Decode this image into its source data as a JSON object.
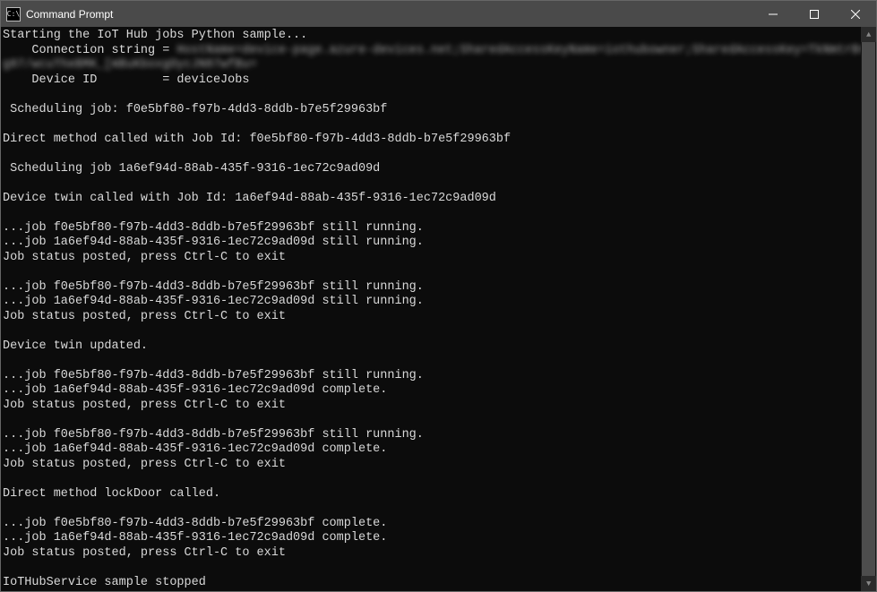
{
  "window": {
    "title": "Command Prompt",
    "sys_icon_label": "C:\\"
  },
  "console": {
    "lines": [
      "Starting the IoT Hub jobs Python sample...",
      "    Connection string = ",
      "",
      "    Device ID         = deviceJobs",
      "",
      " Scheduling job: f0e5bf80-f97b-4dd3-8ddb-b7e5f29963bf",
      "",
      "Direct method called with Job Id: f0e5bf80-f97b-4dd3-8ddb-b7e5f29963bf",
      "",
      " Scheduling job 1a6ef94d-88ab-435f-9316-1ec72c9ad09d",
      "",
      "Device twin called with Job Id: 1a6ef94d-88ab-435f-9316-1ec72c9ad09d",
      "",
      "...job f0e5bf80-f97b-4dd3-8ddb-b7e5f29963bf still running.",
      "...job 1a6ef94d-88ab-435f-9316-1ec72c9ad09d still running.",
      "Job status posted, press Ctrl-C to exit",
      "",
      "...job f0e5bf80-f97b-4dd3-8ddb-b7e5f29963bf still running.",
      "...job 1a6ef94d-88ab-435f-9316-1ec72c9ad09d still running.",
      "Job status posted, press Ctrl-C to exit",
      "",
      "Device twin updated.",
      "",
      "...job f0e5bf80-f97b-4dd3-8ddb-b7e5f29963bf still running.",
      "...job 1a6ef94d-88ab-435f-9316-1ec72c9ad09d complete.",
      "Job status posted, press Ctrl-C to exit",
      "",
      "...job f0e5bf80-f97b-4dd3-8ddb-b7e5f29963bf still running.",
      "...job 1a6ef94d-88ab-435f-9316-1ec72c9ad09d complete.",
      "Job status posted, press Ctrl-C to exit",
      "",
      "Direct method lockDoor called.",
      "",
      "...job f0e5bf80-f97b-4dd3-8ddb-b7e5f29963bf complete.",
      "...job 1a6ef94d-88ab-435f-9316-1ec72c9ad09d complete.",
      "Job status posted, press Ctrl-C to exit",
      "",
      "IoTHubService sample stopped"
    ],
    "redacted_segments": {
      "line1_suffix": "HostName=device-page.azure-devices.net;SharedAccessKeyName=iothubowner;SharedAccessKey=TkNmtrBre",
      "line2": "g07/wcuTheBMK_[mBuKboxgOycJN07wfBu="
    }
  }
}
